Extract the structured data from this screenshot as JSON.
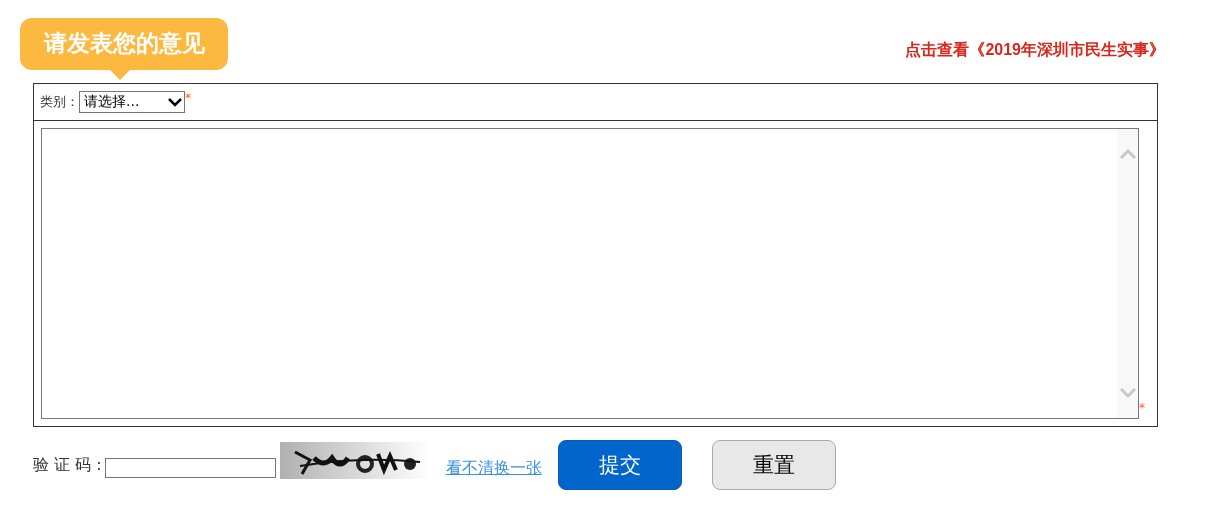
{
  "banner": {
    "title": "请发表您的意见"
  },
  "link": {
    "text": "点击查看《2019年深圳市民生实事》"
  },
  "category": {
    "label": "类别：",
    "value": "请选择...",
    "required_mark": "*"
  },
  "message": {
    "required_mark": "*"
  },
  "captcha": {
    "label": "验 证 码 :",
    "refresh_link": "看不清换一张"
  },
  "buttons": [
    {
      "label": "提交",
      "kind": "primary"
    },
    {
      "label": "重置",
      "kind": "secondary"
    }
  ]
}
